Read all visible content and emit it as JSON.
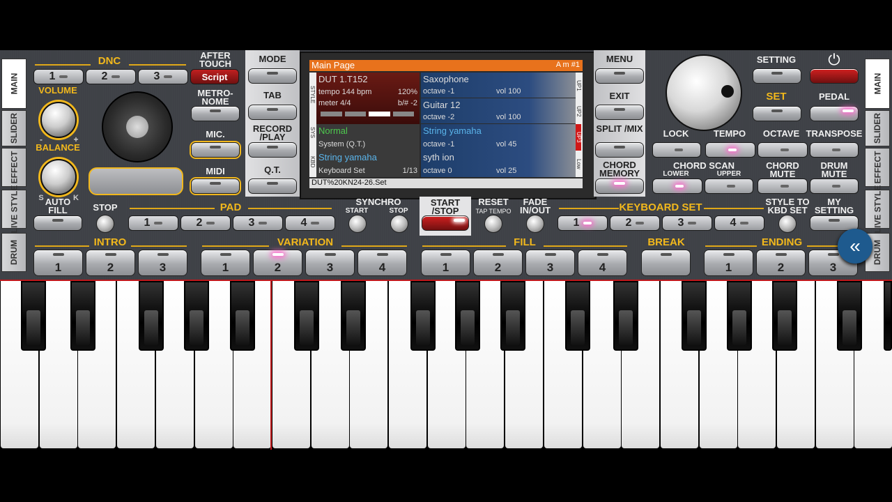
{
  "side_tabs_left": [
    "MAIN",
    "SLIDER",
    "EFFECT",
    "LIVE STYLE",
    "DRUM"
  ],
  "side_tabs_right": [
    "MAIN",
    "SLIDER",
    "EFFECT",
    "LIVE STYLE",
    "DRUM"
  ],
  "dnc": {
    "label": "DNC",
    "buttons": [
      "1",
      "2",
      "3"
    ],
    "script": "Script",
    "after_touch": "AFTER TOUCH"
  },
  "labels": {
    "volume": "VOLUME",
    "balance": "BALANCE",
    "metronome": "METRO- NOME",
    "mic": "MIC.",
    "midi": "MIDI",
    "auto_fill": "AUTO FILL",
    "stop": "STOP",
    "pad": "PAD",
    "synchro": "SYNCHRO",
    "synchro_start": "START",
    "synchro_stop": "STOP",
    "start_stop": "START /STOP",
    "reset": "RESET",
    "tap_tempo": "TAP TEMPO",
    "fade": "FADE IN/OUT",
    "keyboard_set": "KEYBOARD SET",
    "style_to_kbd": "STYLE TO KBD SET",
    "my_setting": "MY SETTING",
    "intro": "INTRO",
    "variation": "VARIATION",
    "fill": "FILL",
    "break": "BREAK",
    "ending": "ENDING",
    "mode": "MODE",
    "tab": "TAB",
    "record_play": "RECORD /PLAY",
    "qt": "Q.T.",
    "menu": "MENU",
    "exit": "EXIT",
    "split_mix": "SPLIT /MIX",
    "chord_memory": "CHORD MEMORY",
    "setting": "SETTING",
    "set": "SET",
    "pedal": "PEDAL",
    "lock": "LOCK",
    "tempo": "TEMPO",
    "octave": "OCTAVE",
    "transpose": "TRANSPOSE",
    "chord_scan": "CHORD SCAN",
    "lower": "LOWER",
    "upper": "UPPER",
    "chord_mute": "CHORD MUTE",
    "drum_mute": "DRUM MUTE",
    "bal_s": "S",
    "bal_k": "K",
    "vol_minus": "-",
    "vol_plus": "+"
  },
  "pad_buttons": [
    "1",
    "2",
    "3",
    "4"
  ],
  "kbd_buttons": [
    "1",
    "2",
    "3",
    "4"
  ],
  "intro_buttons": [
    "1",
    "2",
    "3"
  ],
  "variation_buttons": [
    "1",
    "2",
    "3",
    "4"
  ],
  "fill_buttons": [
    "1",
    "2",
    "3",
    "4"
  ],
  "ending_buttons": [
    "1",
    "2",
    "3"
  ],
  "screen": {
    "title": "Main Page",
    "chord": "A m #1",
    "style": {
      "name": "DUT 1.T152",
      "tempo": "tempo 144 bpm",
      "percent": "120%",
      "meter": "meter 4/4",
      "key": "b/# -2"
    },
    "sys": {
      "name": "Normal",
      "sub": "System (Q.T.)"
    },
    "kbd": {
      "name": "String yamaha",
      "sub": "Keyboard Set",
      "page": "1/13"
    },
    "parts": [
      {
        "name": "Saxophone",
        "octave": "octave -1",
        "vol": "vol 100",
        "tag": "UP1"
      },
      {
        "name": "Guitar 12",
        "octave": "octave -2",
        "vol": "vol 100",
        "tag": "UP2"
      },
      {
        "name": "String yamaha",
        "octave": "octave -1",
        "vol": "vol 45",
        "tag": "UP3"
      },
      {
        "name": "syth ion",
        "octave": "octave  0",
        "vol": "vol 25",
        "tag": "Low"
      }
    ],
    "side_left": [
      "STYLE",
      "SYS",
      "KBD"
    ],
    "footer": "DUT%20KN24-26.Set"
  },
  "colors": {
    "accent": "#f2b81c",
    "title_bar": "#e8721c",
    "red": "#c0181c"
  }
}
